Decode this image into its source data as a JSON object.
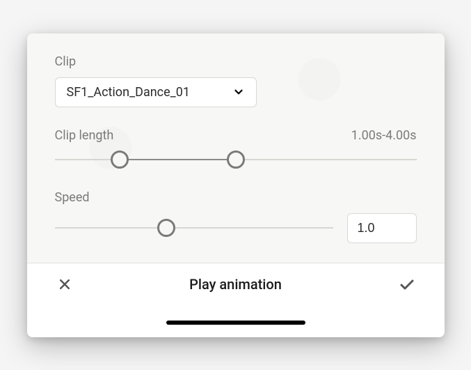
{
  "clip": {
    "label": "Clip",
    "selected": "SF1_Action_Dance_01"
  },
  "clipLength": {
    "label": "Clip length",
    "rangeText": "1.00s-4.00s",
    "minPercent": 18,
    "maxPercent": 50
  },
  "speed": {
    "label": "Speed",
    "valuePercent": 40,
    "value": "1.0"
  },
  "footer": {
    "title": "Play animation"
  },
  "icons": {
    "chevronDown": "chevron-down-icon",
    "close": "close-icon",
    "check": "check-icon"
  }
}
